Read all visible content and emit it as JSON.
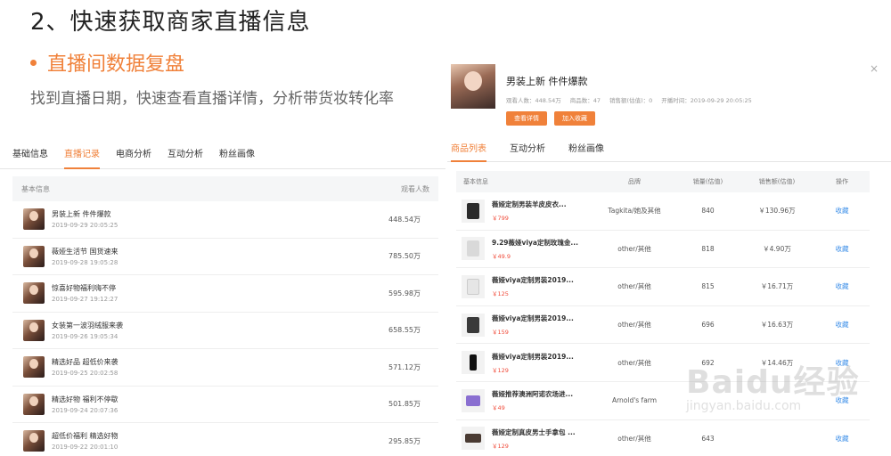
{
  "slide": {
    "title": "2、快速获取商家直播信息",
    "bullet": "直播间数据复盘",
    "description": "找到直播日期，快速查看直播详情，分析带货妆转化率"
  },
  "left": {
    "tabs": [
      {
        "label": "基础信息",
        "active": false
      },
      {
        "label": "直播记录",
        "active": true
      },
      {
        "label": "电商分析",
        "active": false
      },
      {
        "label": "互动分析",
        "active": false
      },
      {
        "label": "粉丝画像",
        "active": false
      }
    ],
    "table": {
      "headers": {
        "info": "基本信息",
        "views": "观看人数"
      },
      "rows": [
        {
          "title": "男装上新 件件爆款",
          "date": "2019-09-29 20:05:25",
          "views": "448.54万"
        },
        {
          "title": "薇娅生活节 国货速来",
          "date": "2019-09-28 19:05:28",
          "views": "785.50万"
        },
        {
          "title": "惊喜好物福利嗨不停",
          "date": "2019-09-27 19:12:27",
          "views": "595.98万"
        },
        {
          "title": "女装第一波羽绒服来袭",
          "date": "2019-09-26 19:05:34",
          "views": "658.55万"
        },
        {
          "title": "精选好品 超低价来袭",
          "date": "2019-09-25 20:02:58",
          "views": "571.12万"
        },
        {
          "title": "精选好物 福利不停歇",
          "date": "2019-09-24 20:07:36",
          "views": "501.85万"
        },
        {
          "title": "超低价福利 精选好物",
          "date": "2019-09-22 20:01:10",
          "views": "295.85万"
        }
      ]
    }
  },
  "right": {
    "close_label": "×",
    "profile": {
      "name": "男装上新 件件爆款",
      "stats": [
        "观看人数：448.54万",
        "商品数：47",
        "销售额(估值)：0",
        "开播时间：2019-09-29 20:05:25"
      ],
      "buttons": [
        "查看详情",
        "加入收藏"
      ]
    },
    "tabs": [
      {
        "label": "商品列表",
        "active": true
      },
      {
        "label": "互动分析",
        "active": false
      },
      {
        "label": "粉丝画像",
        "active": false
      }
    ],
    "table": {
      "headers": [
        "基本信息",
        "品牌",
        "销量(估值)",
        "销售额(估值)",
        "操作"
      ],
      "rows": [
        {
          "title": "薇娅定制男装羊皮皮衣...",
          "price": "￥799",
          "brand": "Tagkita/她及其他",
          "sales": "840",
          "revenue": "￥130.96万",
          "action": "收藏"
        },
        {
          "title": "9.29薇娅viya定制玫瑰金...",
          "price": "￥49.9",
          "brand": "other/其他",
          "sales": "818",
          "revenue": "￥4.90万",
          "action": "收藏"
        },
        {
          "title": "薇娅viya定制男装2019...",
          "price": "￥125",
          "brand": "other/其他",
          "sales": "815",
          "revenue": "￥16.71万",
          "action": "收藏"
        },
        {
          "title": "薇娅viya定制男装2019...",
          "price": "￥159",
          "brand": "other/其他",
          "sales": "696",
          "revenue": "￥16.63万",
          "action": "收藏"
        },
        {
          "title": "薇娅viya定制男装2019...",
          "price": "￥129",
          "brand": "other/其他",
          "sales": "692",
          "revenue": "￥14.46万",
          "action": "收藏"
        },
        {
          "title": "薇娅推荐澳洲阿诺农场进...",
          "price": "￥49",
          "brand": "Arnold's farm",
          "sales": "",
          "revenue": "",
          "action": "收藏"
        },
        {
          "title": "薇娅定制真皮男士手拿包 ...",
          "price": "￥129",
          "brand": "other/其他",
          "sales": "643",
          "revenue": "",
          "action": "收藏"
        }
      ]
    }
  },
  "watermark": {
    "main": "Baidu经验",
    "sub": "jingyan.baidu.com"
  },
  "colors": {
    "accent": "#f0813a",
    "link": "#3d8fe8",
    "price": "#f04b3a"
  }
}
